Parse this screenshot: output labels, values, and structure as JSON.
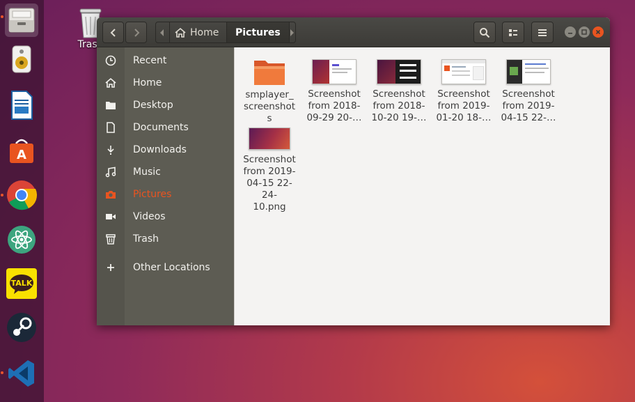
{
  "desktop": {
    "trash_label": "Trash"
  },
  "dock": {
    "items": [
      {
        "name": "files",
        "running": true,
        "active": true
      },
      {
        "name": "rhythmbox",
        "running": false
      },
      {
        "name": "libreoffice-writer",
        "running": false
      },
      {
        "name": "ubuntu-software",
        "running": false
      },
      {
        "name": "chrome",
        "running": true
      },
      {
        "name": "atom",
        "running": false
      },
      {
        "name": "kakaotalk",
        "running": false,
        "label": "TALK"
      },
      {
        "name": "steam",
        "running": false
      },
      {
        "name": "vscode",
        "running": true
      }
    ]
  },
  "header": {
    "breadcrumbs": [
      {
        "label": "Home"
      },
      {
        "label": "Pictures",
        "current": true
      }
    ]
  },
  "sidebar": {
    "items": [
      {
        "label": "Recent",
        "icon": "clock-icon"
      },
      {
        "label": "Home",
        "icon": "home-icon"
      },
      {
        "label": "Desktop",
        "icon": "folder-icon"
      },
      {
        "label": "Documents",
        "icon": "document-icon"
      },
      {
        "label": "Downloads",
        "icon": "download-icon"
      },
      {
        "label": "Music",
        "icon": "music-icon"
      },
      {
        "label": "Pictures",
        "icon": "camera-icon",
        "selected": true
      },
      {
        "label": "Videos",
        "icon": "video-icon"
      },
      {
        "label": "Trash",
        "icon": "trash-icon"
      },
      {
        "label": "Other Locations",
        "icon": "plus-icon"
      }
    ]
  },
  "files": [
    {
      "name": "smplayer_\nscreenshot\ns",
      "type": "folder"
    },
    {
      "name": "Screenshot\nfrom 2018-\n09-29 20-…",
      "type": "image"
    },
    {
      "name": "Screenshot\nfrom 2018-\n10-20 19-…",
      "type": "image"
    },
    {
      "name": "Screenshot\nfrom 2019-\n01-20 18-…",
      "type": "image"
    },
    {
      "name": "Screenshot\nfrom 2019-\n04-15 22-…",
      "type": "image"
    },
    {
      "name": "Screenshot\nfrom 2019-\n04-15 22-24-\n10.png",
      "type": "image"
    }
  ],
  "colors": {
    "accent": "#e95420",
    "sidebar": "#5d5c53",
    "headerbar": "#3c3b37"
  }
}
